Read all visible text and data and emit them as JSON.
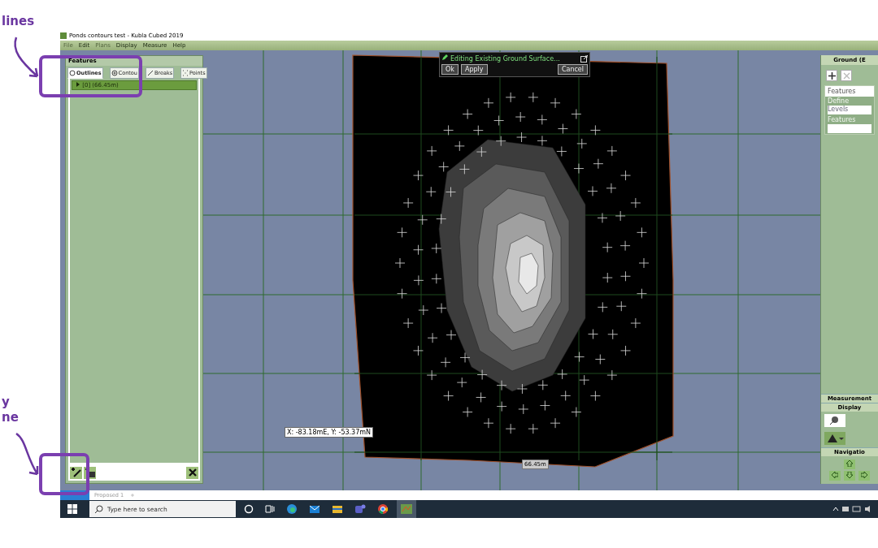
{
  "annotations": {
    "top_label": "lines",
    "bottom_label_lines": [
      "y",
      "ne"
    ]
  },
  "window": {
    "title": "Ponds contours test - Kubla Cubed 2019"
  },
  "menu": [
    {
      "label": "File",
      "disabled": true
    },
    {
      "label": "Edit",
      "disabled": false
    },
    {
      "label": "Plans",
      "disabled": true
    },
    {
      "label": "Display",
      "disabled": false
    },
    {
      "label": "Measure",
      "disabled": false
    },
    {
      "label": "Help",
      "disabled": false
    }
  ],
  "features_panel": {
    "title": "Features",
    "tabs": [
      {
        "label": "Outlines",
        "selected": true,
        "kind": "outline"
      },
      {
        "label": "Contou",
        "selected": false,
        "kind": "contour"
      },
      {
        "label": "Breaks",
        "selected": false,
        "kind": "break"
      },
      {
        "label": "Points",
        "selected": false,
        "kind": "points"
      }
    ],
    "items": [
      {
        "label": "[0] (66.45m)",
        "selected": true
      }
    ]
  },
  "edit_toolbar": {
    "title": "Editing Existing Ground Surface...",
    "buttons": [
      "Ok",
      "Apply",
      "Cancel"
    ]
  },
  "cursor_readout": "X: -83.18mE, Y: -53.37mN",
  "edge_length": "66.45m",
  "right_panel": {
    "title": "Ground (E",
    "features_label": "Features",
    "define_label": "Define",
    "define_value": "Levels",
    "features_field_label": "Features",
    "sections": [
      "Measurement",
      "Display",
      "Navigatio"
    ]
  },
  "bottom_tabs": {
    "tabs": [
      {
        "label": "Proposed 1"
      }
    ],
    "add": "+"
  },
  "taskbar": {
    "search_placeholder": "Type here to search"
  }
}
